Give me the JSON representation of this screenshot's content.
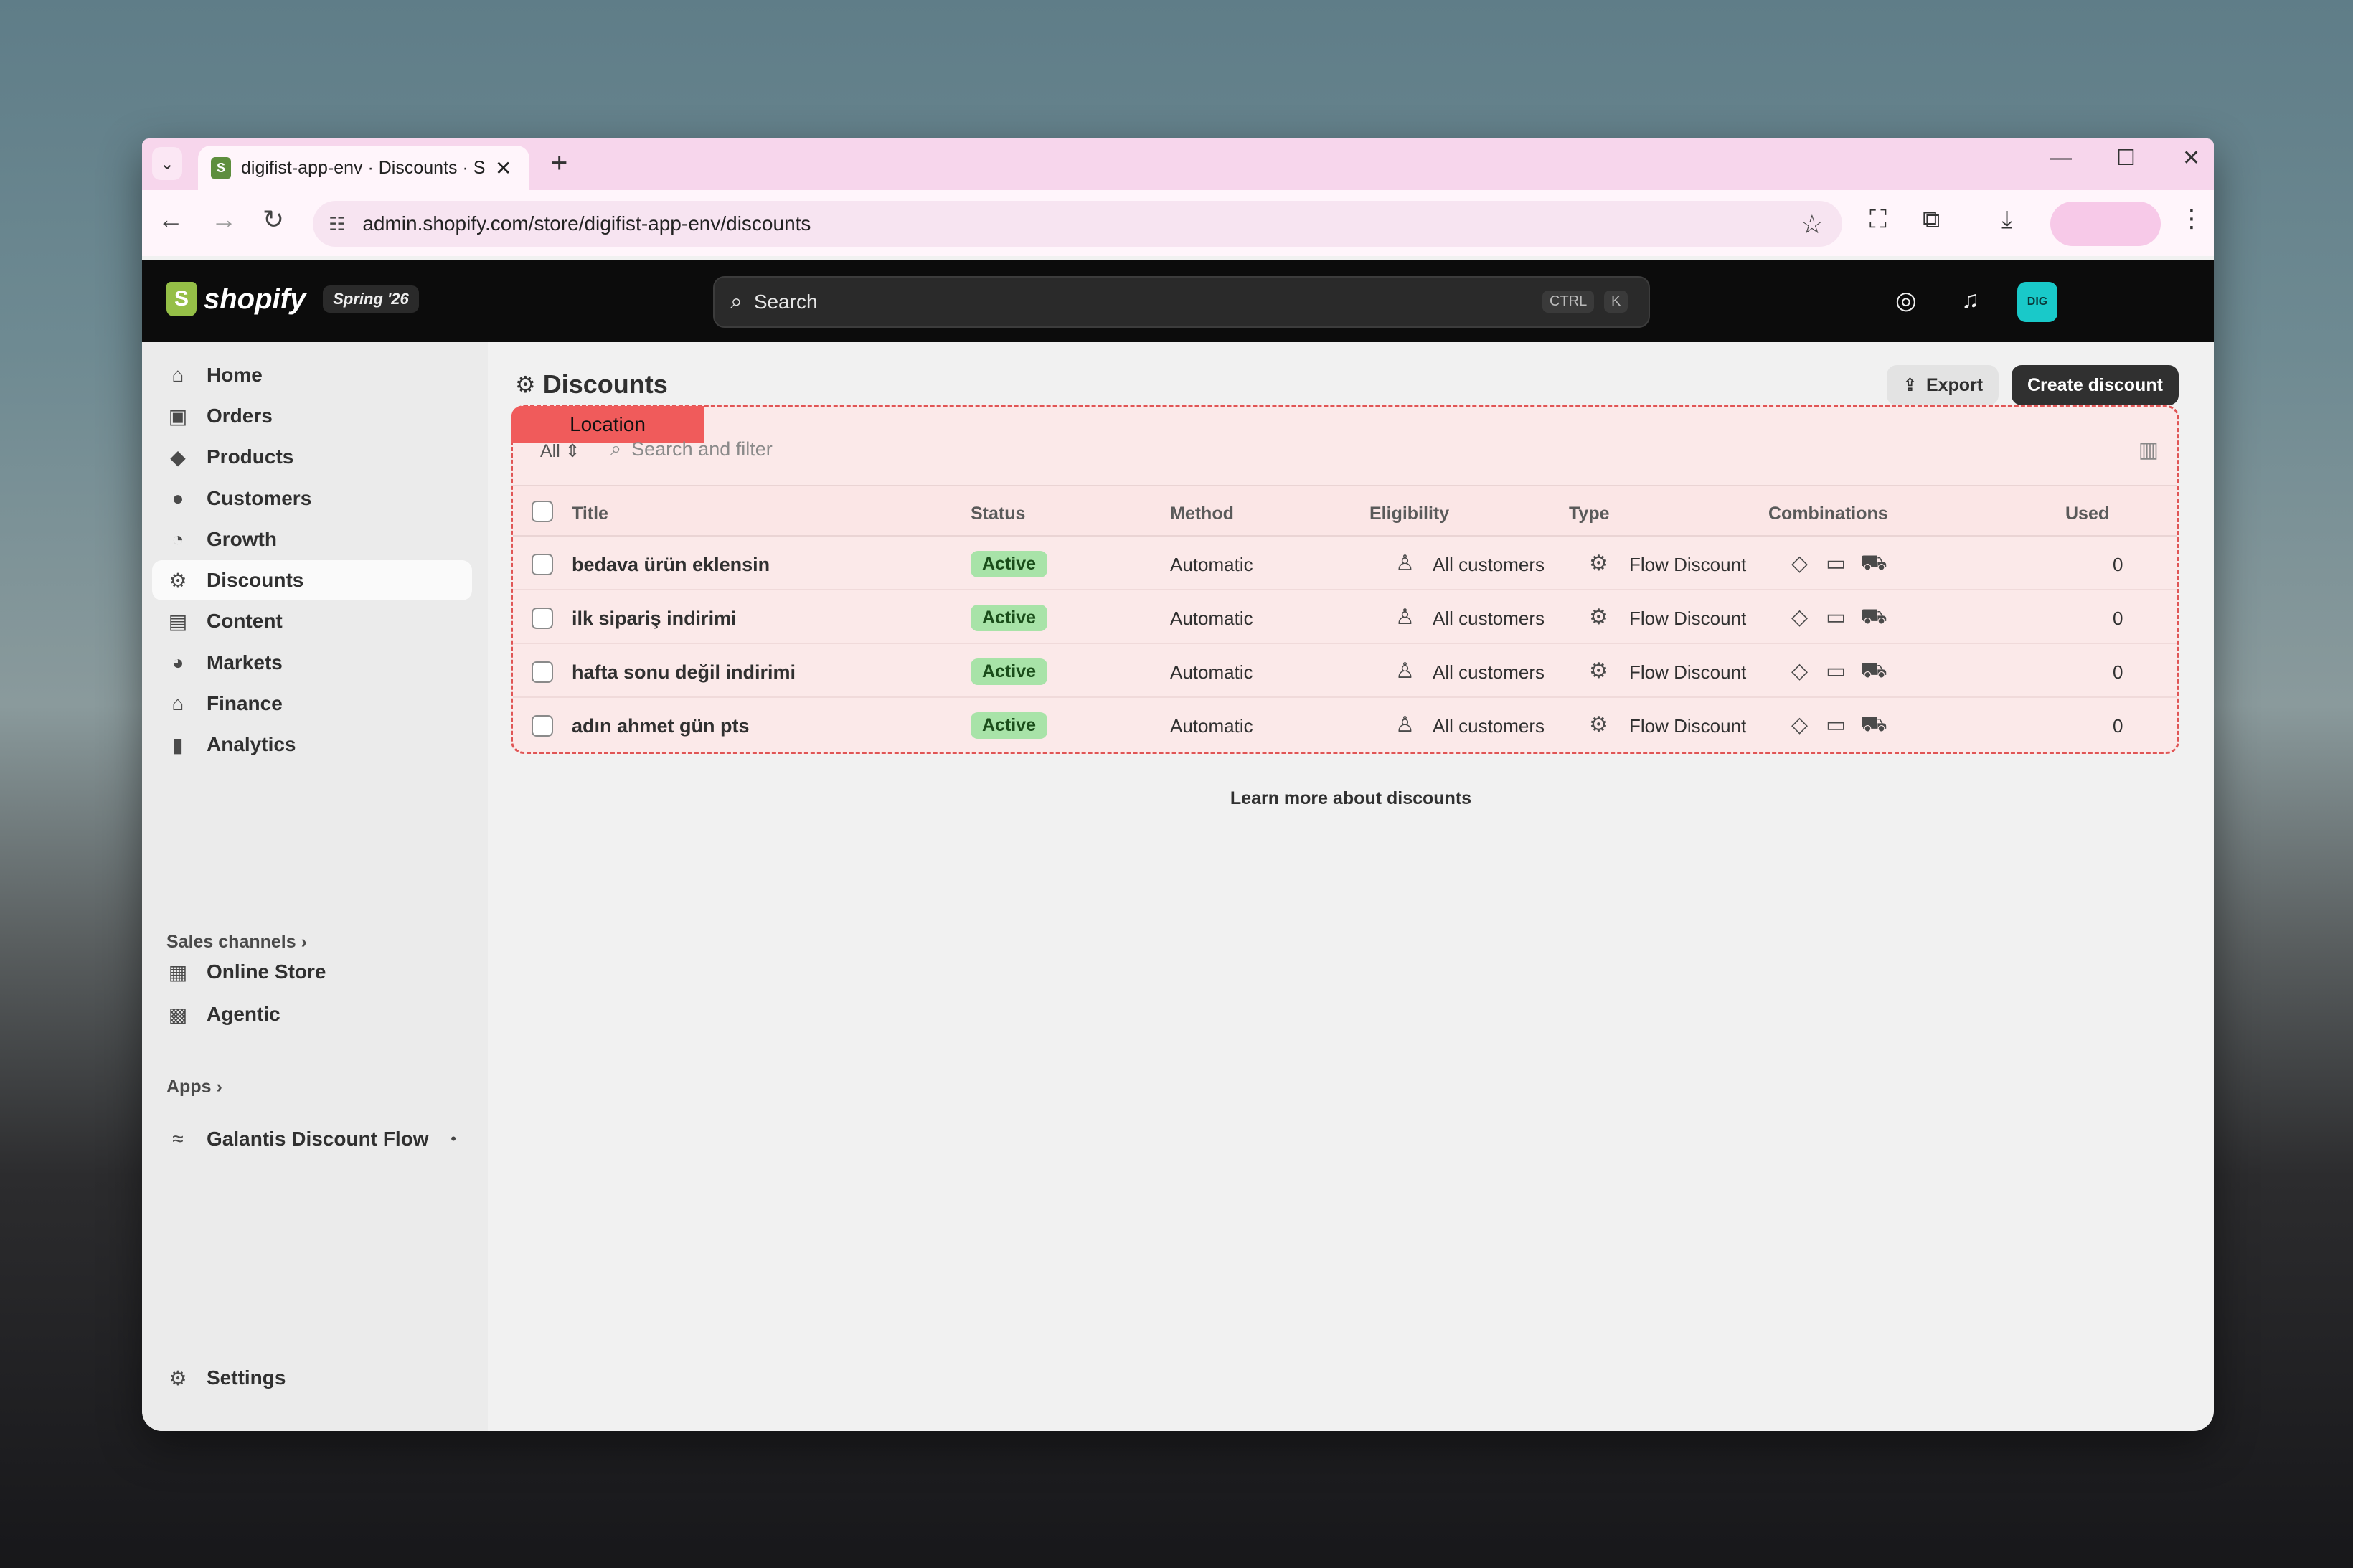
{
  "browser": {
    "tab_title": "digifist-app-env · Discounts · Sh",
    "tab_close": "✕",
    "new_tab": "+",
    "url": "admin.shopify.com/store/digifist-app-env/discounts"
  },
  "shopify": {
    "brand": "shopify",
    "edition_badge": "Spring '26",
    "search_placeholder": "Search",
    "shortcut_ctrl": "CTRL",
    "shortcut_k": "K",
    "avatar_initials": "DIG"
  },
  "sidebar": {
    "items": [
      {
        "label": "Home",
        "icon": "home-icon",
        "glyph": "⌂"
      },
      {
        "label": "Orders",
        "icon": "inbox-icon",
        "glyph": "▣"
      },
      {
        "label": "Products",
        "icon": "tag-icon",
        "glyph": "◆"
      },
      {
        "label": "Customers",
        "icon": "person-icon",
        "glyph": "●"
      },
      {
        "label": "Growth",
        "icon": "gauge-icon",
        "glyph": "◔"
      },
      {
        "label": "Discounts",
        "icon": "discount-icon",
        "glyph": "⚙"
      },
      {
        "label": "Content",
        "icon": "content-icon",
        "glyph": "▤"
      },
      {
        "label": "Markets",
        "icon": "globe-icon",
        "glyph": "◕"
      },
      {
        "label": "Finance",
        "icon": "bank-icon",
        "glyph": "⌂"
      },
      {
        "label": "Analytics",
        "icon": "bar-chart-icon",
        "glyph": "▮"
      }
    ],
    "sales_channels_label": "Sales channels",
    "sales_channels": [
      {
        "label": "Online Store",
        "icon": "store-icon",
        "glyph": "▦"
      },
      {
        "label": "Agentic",
        "icon": "agentic-icon",
        "glyph": "▩"
      }
    ],
    "apps_label": "Apps",
    "apps": [
      {
        "label": "Galantis Discount Flow",
        "icon": "app-flow-icon",
        "glyph": "≈"
      }
    ],
    "settings_label": "Settings"
  },
  "page": {
    "title": "Discounts",
    "export_label": "Export",
    "create_label": "Create discount",
    "location_tag": "Location",
    "filter_all": "All",
    "filter_placeholder": "Search and filter",
    "learn_more": "Learn more about discounts"
  },
  "table": {
    "columns": [
      "Title",
      "Status",
      "Method",
      "Eligibility",
      "Type",
      "Combinations",
      "Used"
    ],
    "rows": [
      {
        "title": "bedava ürün eklensin",
        "status": "Active",
        "method": "Automatic",
        "eligibility": "All customers",
        "type": "Flow Discount",
        "used": "0"
      },
      {
        "title": "ilk sipariş indirimi",
        "status": "Active",
        "method": "Automatic",
        "eligibility": "All customers",
        "type": "Flow Discount",
        "used": "0"
      },
      {
        "title": "hafta sonu değil indirimi",
        "status": "Active",
        "method": "Automatic",
        "eligibility": "All customers",
        "type": "Flow Discount",
        "used": "0"
      },
      {
        "title": "adın ahmet gün pts",
        "status": "Active",
        "method": "Automatic",
        "eligibility": "All customers",
        "type": "Flow Discount",
        "used": "0"
      }
    ]
  },
  "colors": {
    "tab_strip": "#f7d6ec",
    "shopify_header": "#0c0c0c",
    "active_badge": "#a8e3a8",
    "location_highlight": "#e05555",
    "avatar": "#19c9c9"
  }
}
